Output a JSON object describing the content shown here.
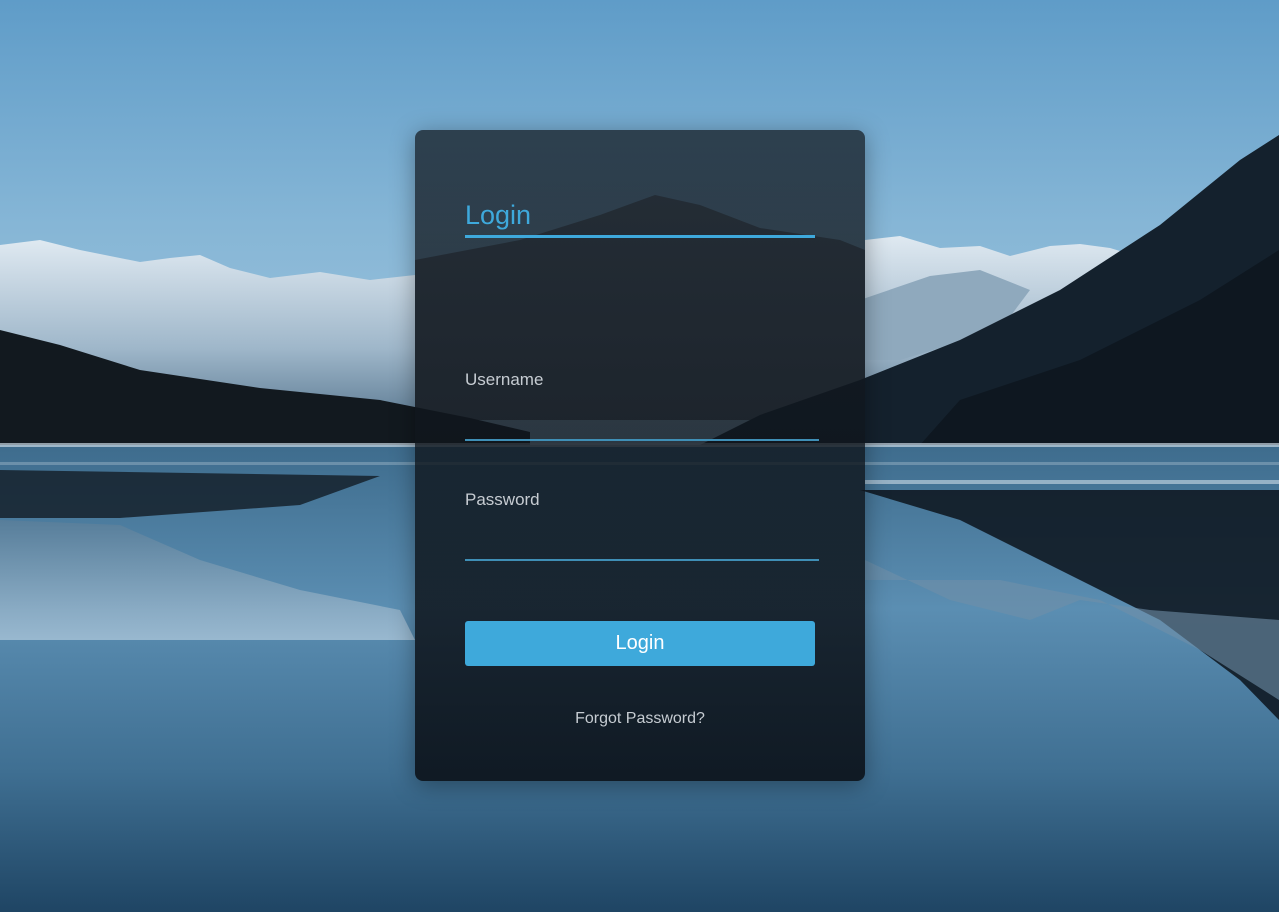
{
  "login_form": {
    "title": "Login",
    "username": {
      "label": "Username",
      "value": "",
      "placeholder": ""
    },
    "password": {
      "label": "Password",
      "value": "",
      "placeholder": ""
    },
    "submit_label": "Login",
    "forgot_password_label": "Forgot Password?"
  },
  "colors": {
    "accent": "#3ea9db",
    "text_muted": "#c6ccd2",
    "card_background": "#0d1319"
  }
}
